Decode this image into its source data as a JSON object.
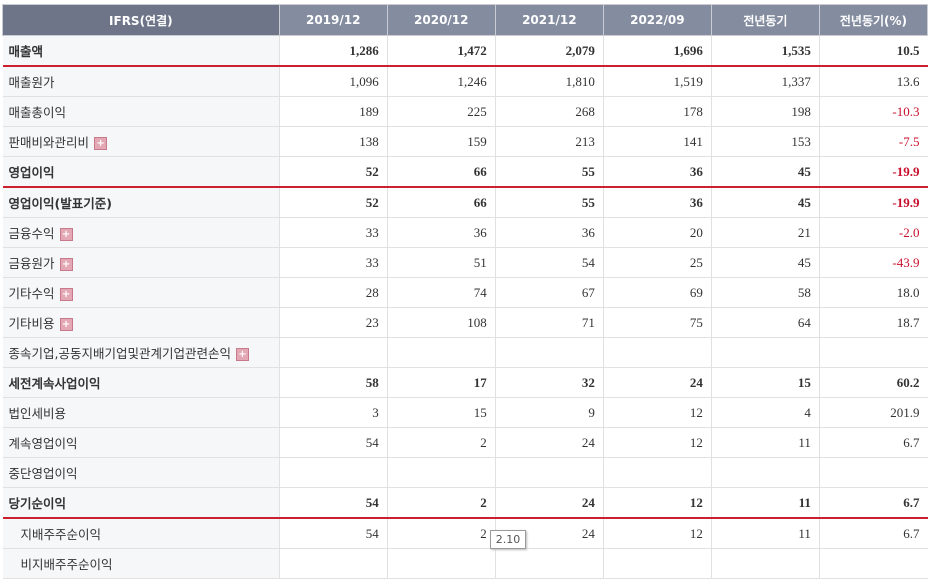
{
  "header": {
    "label_col": "IFRS(연결)",
    "columns": [
      "2019/12",
      "2020/12",
      "2021/12",
      "2022/09",
      "전년동기",
      "전년동기(%)"
    ]
  },
  "rows": [
    {
      "label": "매출액",
      "values": [
        "1,286",
        "1,472",
        "2,079",
        "1,696",
        "1,535",
        "10.5"
      ],
      "bold": true,
      "redline": true,
      "expand": false,
      "sub": false
    },
    {
      "label": "매출원가",
      "values": [
        "1,096",
        "1,246",
        "1,810",
        "1,519",
        "1,337",
        "13.6"
      ],
      "bold": false,
      "redline": false,
      "expand": false,
      "sub": false
    },
    {
      "label": "매출총이익",
      "values": [
        "189",
        "225",
        "268",
        "178",
        "198",
        "-10.3"
      ],
      "bold": false,
      "redline": false,
      "expand": false,
      "sub": false
    },
    {
      "label": "판매비와관리비",
      "values": [
        "138",
        "159",
        "213",
        "141",
        "153",
        "-7.5"
      ],
      "bold": false,
      "redline": false,
      "expand": true,
      "sub": false
    },
    {
      "label": "영업이익",
      "values": [
        "52",
        "66",
        "55",
        "36",
        "45",
        "-19.9"
      ],
      "bold": true,
      "redline": true,
      "expand": false,
      "sub": false
    },
    {
      "label": "영업이익(발표기준)",
      "values": [
        "52",
        "66",
        "55",
        "36",
        "45",
        "-19.9"
      ],
      "bold": true,
      "redline": false,
      "expand": false,
      "sub": false
    },
    {
      "label": "금융수익",
      "values": [
        "33",
        "36",
        "36",
        "20",
        "21",
        "-2.0"
      ],
      "bold": false,
      "redline": false,
      "expand": true,
      "sub": false
    },
    {
      "label": "금융원가",
      "values": [
        "33",
        "51",
        "54",
        "25",
        "45",
        "-43.9"
      ],
      "bold": false,
      "redline": false,
      "expand": true,
      "sub": false
    },
    {
      "label": "기타수익",
      "values": [
        "28",
        "74",
        "67",
        "69",
        "58",
        "18.0"
      ],
      "bold": false,
      "redline": false,
      "expand": true,
      "sub": false
    },
    {
      "label": "기타비용",
      "values": [
        "23",
        "108",
        "71",
        "75",
        "64",
        "18.7"
      ],
      "bold": false,
      "redline": false,
      "expand": true,
      "sub": false
    },
    {
      "label": "종속기업,공동지배기업및관계기업관련손익",
      "values": [
        "",
        "",
        "",
        "",
        "",
        ""
      ],
      "bold": false,
      "redline": false,
      "expand": true,
      "sub": false
    },
    {
      "label": "세전계속사업이익",
      "values": [
        "58",
        "17",
        "32",
        "24",
        "15",
        "60.2"
      ],
      "bold": true,
      "redline": false,
      "expand": false,
      "sub": false
    },
    {
      "label": "법인세비용",
      "values": [
        "3",
        "15",
        "9",
        "12",
        "4",
        "201.9"
      ],
      "bold": false,
      "redline": false,
      "expand": false,
      "sub": false
    },
    {
      "label": "계속영업이익",
      "values": [
        "54",
        "2",
        "24",
        "12",
        "11",
        "6.7"
      ],
      "bold": false,
      "redline": false,
      "expand": false,
      "sub": false
    },
    {
      "label": "중단영업이익",
      "values": [
        "",
        "",
        "",
        "",
        "",
        ""
      ],
      "bold": false,
      "redline": false,
      "expand": false,
      "sub": false
    },
    {
      "label": "당기순이익",
      "values": [
        "54",
        "2",
        "24",
        "12",
        "11",
        "6.7"
      ],
      "bold": true,
      "redline": true,
      "expand": false,
      "sub": false
    },
    {
      "label": "지배주주순이익",
      "values": [
        "54",
        "2",
        "24",
        "12",
        "11",
        "6.7"
      ],
      "bold": false,
      "redline": false,
      "expand": false,
      "sub": true
    },
    {
      "label": "비지배주주순이익",
      "values": [
        "",
        "",
        "",
        "",
        "",
        ""
      ],
      "bold": false,
      "redline": false,
      "expand": false,
      "sub": true
    }
  ],
  "tooltip": {
    "text": "2.10"
  },
  "colors": {
    "header_bg": "#848ca0",
    "negative": "#c8102e",
    "section_line": "#cc1f2f"
  },
  "icons": {
    "expand": "plus-square-icon"
  }
}
